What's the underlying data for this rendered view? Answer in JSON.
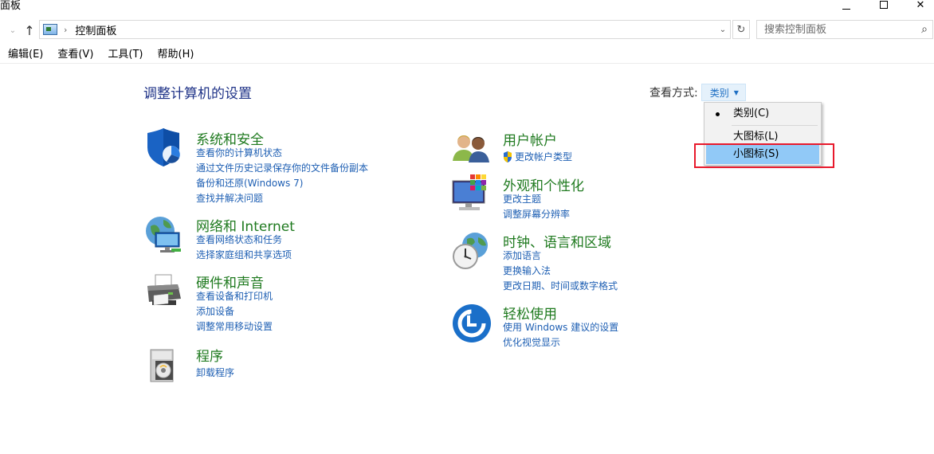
{
  "window": {
    "title": "面板"
  },
  "address_bar": {
    "path_label": "控制面板",
    "search_placeholder": "搜索控制面板"
  },
  "menu": {
    "items": [
      "编辑(E)",
      "查看(V)",
      "工具(T)",
      "帮助(H)"
    ]
  },
  "main": {
    "title": "调整计算机的设置",
    "view_by_label": "查看方式:",
    "view_by_value": "类别"
  },
  "view_menu": {
    "items": [
      "类别(C)",
      "大图标(L)",
      "小图标(S)"
    ],
    "selected": "类别(C)",
    "highlighted": "小图标(S)"
  },
  "categories": [
    {
      "title": "系统和安全",
      "icon": "shield-icon",
      "links": [
        "查看你的计算机状态",
        "通过文件历史记录保存你的文件备份副本",
        "备份和还原(Windows 7)",
        "查找并解决问题"
      ]
    },
    {
      "title": "网络和 Internet",
      "icon": "network-globe-icon",
      "links": [
        "查看网络状态和任务",
        "选择家庭组和共享选项"
      ]
    },
    {
      "title": "硬件和声音",
      "icon": "printer-icon",
      "links": [
        "查看设备和打印机",
        "添加设备",
        "调整常用移动设置"
      ]
    },
    {
      "title": "程序",
      "icon": "programs-icon",
      "links": [
        "卸载程序"
      ]
    },
    {
      "title": "用户帐户",
      "icon": "users-icon",
      "links": [
        "更改帐户类型"
      ]
    },
    {
      "title": "外观和个性化",
      "icon": "monitor-palette-icon",
      "links": [
        "更改主题",
        "调整屏幕分辨率"
      ]
    },
    {
      "title": "时钟、语言和区域",
      "icon": "clock-globe-icon",
      "links": [
        "添加语言",
        "更换输入法",
        "更改日期、时间或数字格式"
      ]
    },
    {
      "title": "轻松使用",
      "icon": "ease-of-access-icon",
      "links": [
        "使用 Windows 建议的设置",
        "优化视觉显示"
      ]
    }
  ],
  "colors": {
    "title_blue": "#1e3287",
    "category_green": "#1f7a1f",
    "link_blue": "#1e5fb3",
    "menu_highlight": "#91c9f7",
    "annotation_red": "#e8192c"
  }
}
